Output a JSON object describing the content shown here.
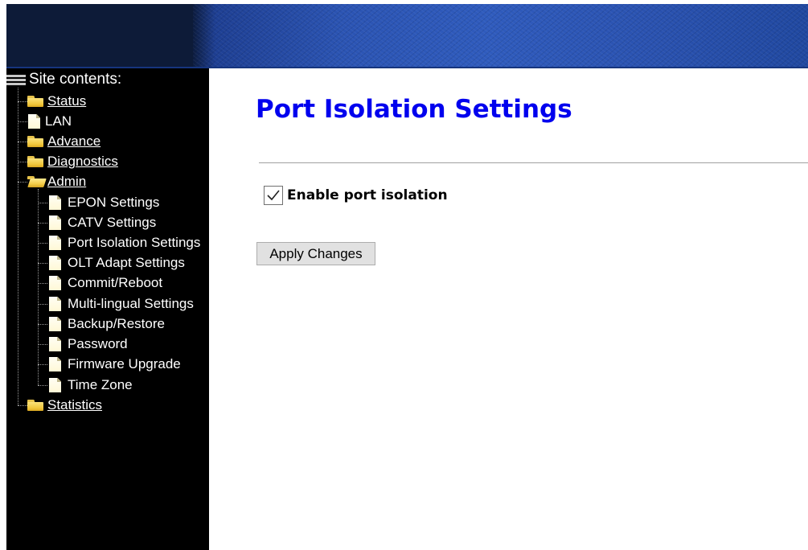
{
  "colors": {
    "title": "#0000ee",
    "sidebar_bg": "#000000",
    "sidebar_text": "#ffffff",
    "banner_left": "#0d1b38",
    "banner_right": "#2f5bbd"
  },
  "sidebar": {
    "root_label": "Site contents:",
    "root_icon": "tree-root-icon",
    "items": [
      {
        "label": "Status",
        "icon": "folder-icon",
        "link": true
      },
      {
        "label": "LAN",
        "icon": "document-icon",
        "link": false
      },
      {
        "label": "Advance",
        "icon": "folder-icon",
        "link": true
      },
      {
        "label": "Diagnostics",
        "icon": "folder-icon",
        "link": true
      },
      {
        "label": "Admin",
        "icon": "folder-open-icon",
        "link": true
      },
      {
        "label": "EPON Settings",
        "icon": "document-icon",
        "link": false
      },
      {
        "label": "CATV Settings",
        "icon": "document-icon",
        "link": false
      },
      {
        "label": "Port Isolation Settings",
        "icon": "document-icon",
        "link": false
      },
      {
        "label": "OLT Adapt Settings",
        "icon": "document-icon",
        "link": false
      },
      {
        "label": "Commit/Reboot",
        "icon": "document-icon",
        "link": false
      },
      {
        "label": "Multi-lingual Settings",
        "icon": "document-icon",
        "link": false
      },
      {
        "label": "Backup/Restore",
        "icon": "document-icon",
        "link": false
      },
      {
        "label": "Password",
        "icon": "document-icon",
        "link": false
      },
      {
        "label": "Firmware Upgrade",
        "icon": "document-icon",
        "link": false
      },
      {
        "label": "Time Zone",
        "icon": "document-icon",
        "link": false
      },
      {
        "label": "Statistics",
        "icon": "folder-icon",
        "link": true
      }
    ]
  },
  "main": {
    "title": "Port Isolation Settings",
    "enable_port_isolation": {
      "label": "Enable port isolation",
      "checked": true
    },
    "apply_button": "Apply Changes"
  }
}
